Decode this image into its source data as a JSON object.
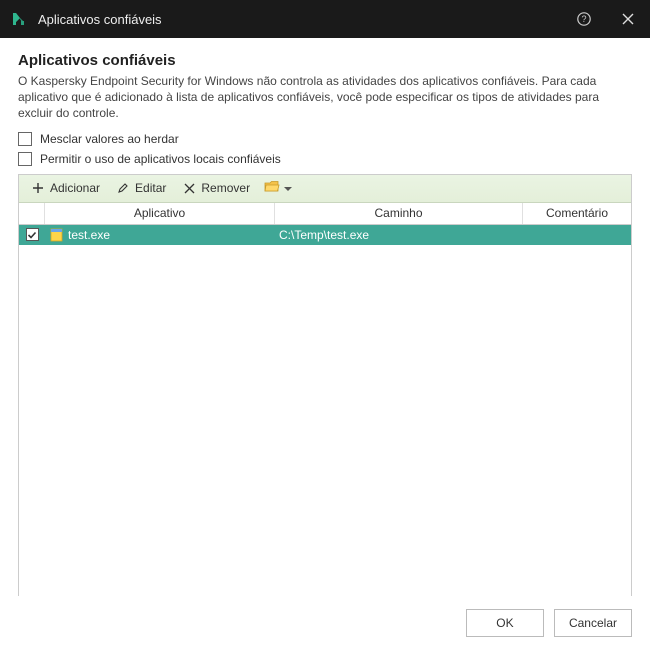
{
  "window": {
    "title": "Aplicativos confiáveis"
  },
  "page": {
    "heading": "Aplicativos confiáveis",
    "description": "O Kaspersky Endpoint Security for Windows não controla as atividades dos aplicativos confiáveis. Para cada aplicativo que é adicionado à lista de aplicativos confiáveis, você pode especificar os tipos de atividades para excluir do controle."
  },
  "options": {
    "merge_inherit": {
      "label": "Mesclar valores ao herdar",
      "checked": false
    },
    "allow_local": {
      "label": "Permitir o uso de aplicativos locais confiáveis",
      "checked": false
    }
  },
  "toolbar": {
    "add": "Adicionar",
    "edit": "Editar",
    "remove": "Remover"
  },
  "columns": {
    "app": "Aplicativo",
    "path": "Caminho",
    "comment": "Comentário"
  },
  "rows": [
    {
      "checked": true,
      "app": "test.exe",
      "path": "C:\\Temp\\test.exe",
      "comment": ""
    }
  ],
  "buttons": {
    "ok": "OK",
    "cancel": "Cancelar"
  }
}
